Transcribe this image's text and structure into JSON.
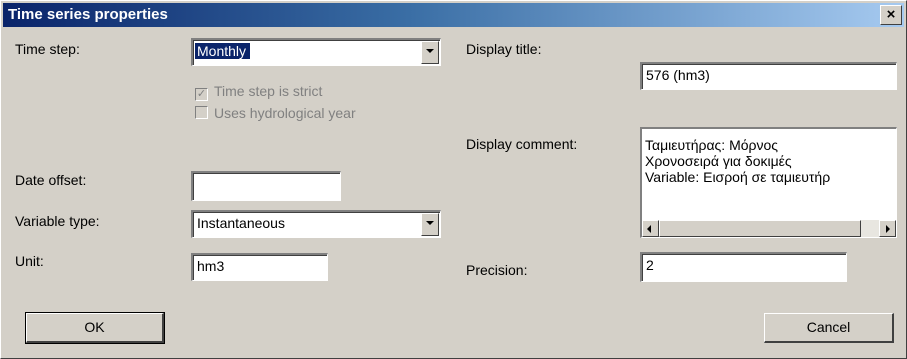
{
  "window": {
    "title": "Time series properties",
    "close_glyph": "×"
  },
  "left": {
    "time_step_label": "Time step:",
    "time_step_value": "Monthly",
    "strict_label": "Time step is strict",
    "strict_checked": true,
    "hydro_label": "Uses hydrological year",
    "hydro_checked": false,
    "date_offset_label": "Date offset:",
    "date_offset_value": "",
    "variable_type_label": "Variable type:",
    "variable_type_value": "Instantaneous",
    "unit_label": "Unit:",
    "unit_value": "hm3"
  },
  "right": {
    "display_title_label": "Display title:",
    "display_title_value": "576 (hm3)",
    "display_comment_label": "Display comment:",
    "comment_lines": [
      "Ταμιευτήρας: Μόρνος",
      "Χρονοσειρά για δοκιμές",
      "Variable: Εισροή σε ταμιευτήρ"
    ],
    "precision_label": "Precision:",
    "precision_value": "2"
  },
  "buttons": {
    "ok": "OK",
    "cancel": "Cancel"
  },
  "icons": {
    "close": "close-icon",
    "dropdown": "chevron-down-icon",
    "check": "checkmark-icon",
    "scroll_left": "arrow-left-icon",
    "scroll_right": "arrow-right-icon"
  },
  "colors": {
    "titlebar_start": "#0a246a",
    "titlebar_end": "#a6caf0",
    "face": "#d4d0c8"
  }
}
